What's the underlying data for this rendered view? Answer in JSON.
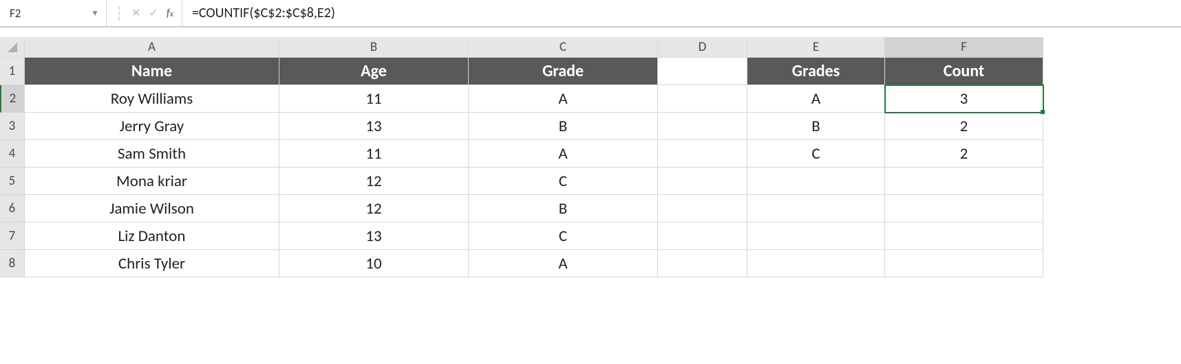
{
  "formula_bar": {
    "cell_ref": "F2",
    "formula": "=COUNTIF($C$2:$C$8,E2)"
  },
  "columns": [
    "A",
    "B",
    "C",
    "D",
    "E",
    "F"
  ],
  "row_numbers": [
    "1",
    "2",
    "3",
    "4",
    "5",
    "6",
    "7",
    "8"
  ],
  "headers": {
    "A": "Name",
    "B": "Age",
    "C": "Grade",
    "D": "",
    "E": "Grades",
    "F": "Count"
  },
  "rows": [
    {
      "A": "Roy Williams",
      "B": "11",
      "C": "A",
      "D": "",
      "E": "A",
      "F": "3"
    },
    {
      "A": "Jerry Gray",
      "B": "13",
      "C": "B",
      "D": "",
      "E": "B",
      "F": "2"
    },
    {
      "A": "Sam Smith",
      "B": "11",
      "C": "A",
      "D": "",
      "E": "C",
      "F": "2"
    },
    {
      "A": "Mona kriar",
      "B": "12",
      "C": "C",
      "D": "",
      "E": "",
      "F": ""
    },
    {
      "A": "Jamie Wilson",
      "B": "12",
      "C": "B",
      "D": "",
      "E": "",
      "F": ""
    },
    {
      "A": "Liz Danton",
      "B": "13",
      "C": "C",
      "D": "",
      "E": "",
      "F": ""
    },
    {
      "A": "Chris Tyler",
      "B": "10",
      "C": "A",
      "D": "",
      "E": "",
      "F": ""
    }
  ],
  "active_cell": "F2"
}
